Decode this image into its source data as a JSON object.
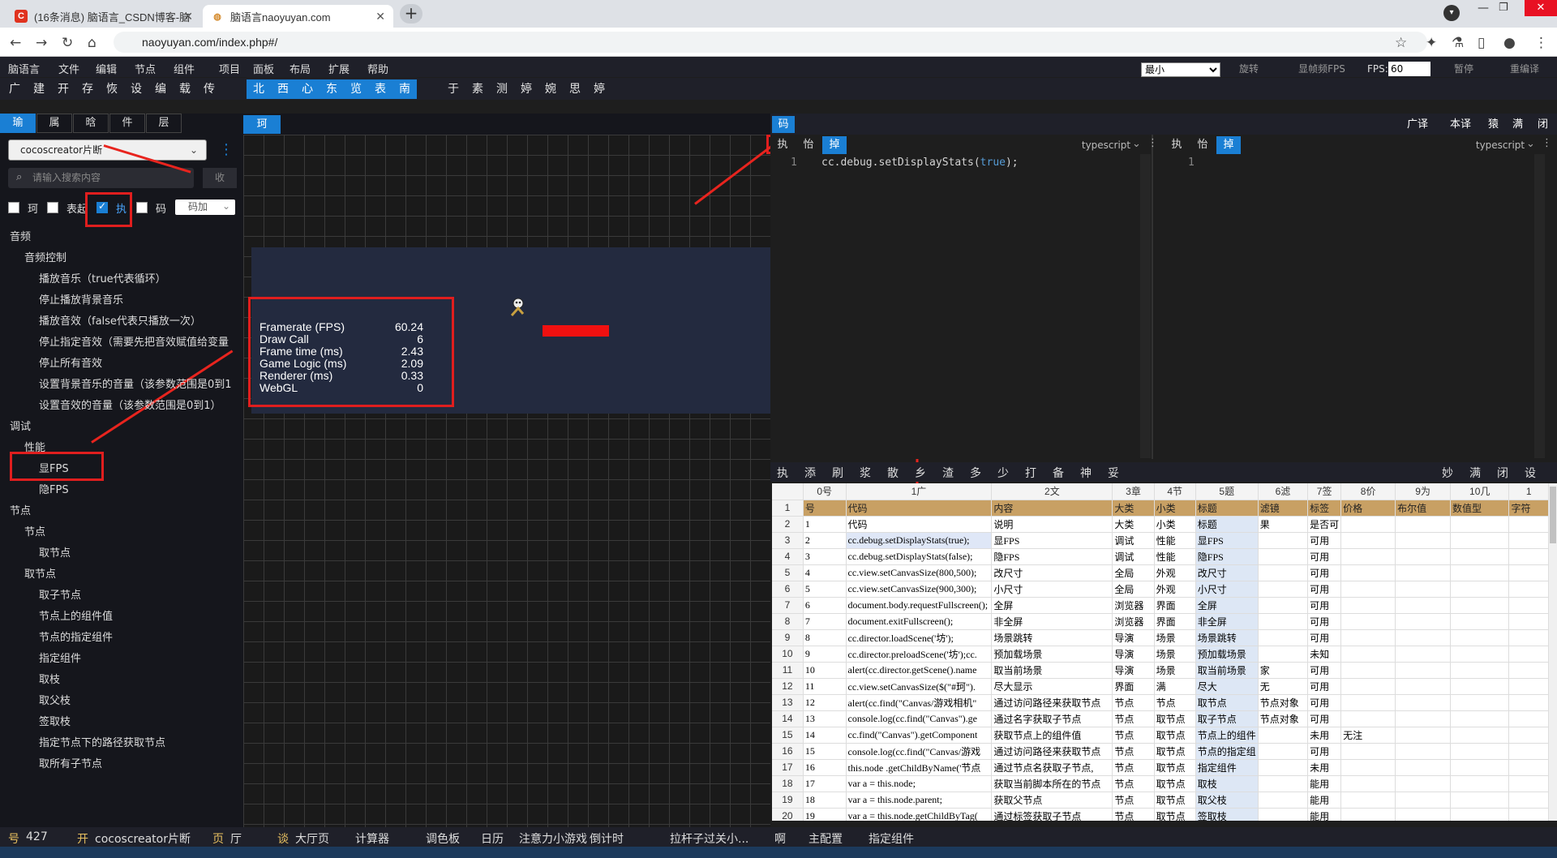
{
  "browser": {
    "tabs": [
      {
        "title": "(16条消息) 脑语言_CSDN博客-脑",
        "fav": "C"
      },
      {
        "title": "脑语言naoyuyan.com",
        "fav": "🧠"
      }
    ],
    "url": "naoyuyan.com/index.php#/"
  },
  "menubar": [
    "脑语言",
    "文件",
    "编辑",
    "节点",
    "组件",
    "项目",
    "面板",
    "布局",
    "扩展",
    "帮助"
  ],
  "toolbar": {
    "plain1": [
      "广",
      "建",
      "开",
      "存",
      "恢",
      "设",
      "编",
      "载",
      "传"
    ],
    "blue": [
      "北",
      "西",
      "心",
      "东",
      "览",
      "表",
      "南"
    ],
    "plain2": [
      "于",
      "素",
      "测",
      "婷",
      "婉",
      "思",
      "婷"
    ]
  },
  "controls": {
    "size_select": "最小",
    "rotate": "旋转",
    "show_fps": "显帧频FPS",
    "fps_label": "FPS:",
    "fps_value": "60",
    "pause": "暂停",
    "reload": "重编译"
  },
  "left": {
    "tabs": [
      "瑜",
      "属",
      "晗",
      "件",
      "层"
    ],
    "dropdown": "cocoscreator片断",
    "search_placeholder": "请输入搜索内容",
    "collapse": "收",
    "checks": [
      "珂",
      "表起",
      "执",
      "码"
    ],
    "code_add": "码加",
    "tree": [
      {
        "t": "音频",
        "l": 0
      },
      {
        "t": "音频控制",
        "l": 1
      },
      {
        "t": "播放音乐（true代表循环）",
        "l": 2
      },
      {
        "t": "停止播放背景音乐",
        "l": 2
      },
      {
        "t": "播放音效（false代表只播放一次）",
        "l": 2
      },
      {
        "t": "停止指定音效（需要先把音效赋值给变量",
        "l": 2
      },
      {
        "t": "停止所有音效",
        "l": 2
      },
      {
        "t": "设置背景音乐的音量（该参数范围是0到1",
        "l": 2
      },
      {
        "t": "设置音效的音量（该参数范围是0到1）",
        "l": 2
      },
      {
        "t": "调试",
        "l": 0
      },
      {
        "t": "性能",
        "l": 1
      },
      {
        "t": "显FPS",
        "l": 2
      },
      {
        "t": "隐FPS",
        "l": 2
      },
      {
        "t": "节点",
        "l": 0
      },
      {
        "t": "节点",
        "l": 1
      },
      {
        "t": "取节点",
        "l": 2
      },
      {
        "t": "取节点",
        "l": 1
      },
      {
        "t": "取子节点",
        "l": 2
      },
      {
        "t": "节点上的组件值",
        "l": 2
      },
      {
        "t": "节点的指定组件",
        "l": 2
      },
      {
        "t": "指定组件",
        "l": 2
      },
      {
        "t": "取枝",
        "l": 2
      },
      {
        "t": "取父枝",
        "l": 2
      },
      {
        "t": "签取枝",
        "l": 2
      },
      {
        "t": "指定节点下的路径获取节点",
        "l": 2
      },
      {
        "t": "取所有子节点",
        "l": 2
      }
    ]
  },
  "scene": {
    "tab": "珂",
    "stats": [
      {
        "k": "Framerate (FPS)",
        "v": "60.24"
      },
      {
        "k": "Draw Call",
        "v": "6"
      },
      {
        "k": "Frame time (ms)",
        "v": "2.43"
      },
      {
        "k": "Game Logic (ms)",
        "v": "2.09"
      },
      {
        "k": "Renderer (ms)",
        "v": "0.33"
      },
      {
        "k": "WebGL",
        "v": "0"
      }
    ]
  },
  "editor": {
    "section": "码",
    "right_tabs": [
      "广译",
      "本译",
      "猿",
      "满",
      "闭"
    ],
    "tabs": [
      "执",
      "怡",
      "掉"
    ],
    "lang": "typescript",
    "line_no": "1",
    "code_pre": "cc.debug.setDisplayStats(",
    "code_kw": "true",
    "code_post": ");"
  },
  "grid": {
    "toolbar_left": [
      "执",
      "添",
      "刷",
      "浆",
      "散",
      "乡",
      "渣",
      "多",
      "少",
      "打",
      "备",
      "神",
      "妥"
    ],
    "toolbar_right": [
      "妙",
      "满",
      "闭",
      "设"
    ],
    "colheads": [
      "",
      "0号",
      "1广",
      "2文",
      "3章",
      "4节",
      "5题",
      "6滤",
      "7签",
      "8价",
      "9为",
      "10几",
      "1"
    ],
    "rows": [
      [
        "1",
        "号",
        "代码",
        "内容",
        "大类",
        "小类",
        "标题",
        "滤镜",
        "标签",
        "价格",
        "布尔值",
        "数值型",
        "字符"
      ],
      [
        "2",
        "1",
        "代码",
        "说明",
        "大类",
        "小类",
        "标题",
        "果",
        "是否可",
        "",
        "",
        "",
        ""
      ],
      [
        "3",
        "2",
        "cc.debug.setDisplayStats(true);",
        "显FPS",
        "调试",
        "性能",
        "显FPS",
        "",
        "可用",
        "",
        "",
        "",
        ""
      ],
      [
        "4",
        "3",
        "cc.debug.setDisplayStats(false);",
        "隐FPS",
        "调试",
        "性能",
        "隐FPS",
        "",
        "可用",
        "",
        "",
        "",
        ""
      ],
      [
        "5",
        "4",
        "cc.view.setCanvasSize(800,500);",
        "改尺寸",
        "全局",
        "外观",
        "改尺寸",
        "",
        "可用",
        "",
        "",
        "",
        ""
      ],
      [
        "6",
        "5",
        "cc.view.setCanvasSize(900,300);",
        "小尺寸",
        "全局",
        "外观",
        "小尺寸",
        "",
        "可用",
        "",
        "",
        "",
        ""
      ],
      [
        "7",
        "6",
        "document.body.requestFullscreen();",
        "全屏",
        "浏览器",
        "界面",
        "全屏",
        "",
        "可用",
        "",
        "",
        "",
        ""
      ],
      [
        "8",
        "7",
        "document.exitFullscreen();",
        "非全屏",
        "浏览器",
        "界面",
        "非全屏",
        "",
        "可用",
        "",
        "",
        "",
        ""
      ],
      [
        "9",
        "8",
        "cc.director.loadScene('坊');",
        "场景跳转",
        "导演",
        "场景",
        "场景跳转",
        "",
        "可用",
        "",
        "",
        "",
        ""
      ],
      [
        "10",
        "9",
        "cc.director.preloadScene('坊');cc.",
        "预加载场景",
        "导演",
        "场景",
        "预加载场景",
        "",
        "未知",
        "",
        "",
        "",
        ""
      ],
      [
        "11",
        "10",
        "alert(cc.director.getScene().name",
        "取当前场景",
        "导演",
        "场景",
        "取当前场景",
        "家",
        "可用",
        "",
        "",
        "",
        ""
      ],
      [
        "12",
        "11",
        "cc.view.setCanvasSize($(\"#珂\").",
        "尽大显示",
        "界面",
        "满",
        "尽大",
        "无",
        "可用",
        "",
        "",
        "",
        ""
      ],
      [
        "13",
        "12",
        "alert(cc.find(\"Canvas/游戏相机\"",
        "通过访问路径来获取节点",
        "节点",
        "节点",
        "取节点",
        "节点对象",
        "可用",
        "",
        "",
        "",
        ""
      ],
      [
        "14",
        "13",
        "console.log(cc.find(\"Canvas\").ge",
        "通过名字获取子节点",
        "节点",
        "取节点",
        "取子节点",
        "节点对象",
        "可用",
        "",
        "",
        "",
        ""
      ],
      [
        "15",
        "14",
        "cc.find(\"Canvas\").getComponent",
        "获取节点上的组件值",
        "节点",
        "取节点",
        "节点上的组件",
        "",
        "未用",
        "无注",
        "",
        "",
        ""
      ],
      [
        "16",
        "15",
        "console.log(cc.find(\"Canvas/游戏",
        "通过访问路径来获取节点",
        "节点",
        "取节点",
        "节点的指定组",
        "",
        "可用",
        "",
        "",
        "",
        ""
      ],
      [
        "17",
        "16",
        "this.node .getChildByName('节点",
        "通过节点名获取子节点,",
        "节点",
        "取节点",
        "指定组件",
        "",
        "未用",
        "",
        "",
        "",
        ""
      ],
      [
        "18",
        "17",
        "var a = this.node;",
        "获取当前脚本所在的节点",
        "节点",
        "取节点",
        "取枝",
        "",
        "能用",
        "",
        "",
        "",
        ""
      ],
      [
        "19",
        "18",
        "var a = this.node.parent;",
        "获取父节点",
        "节点",
        "取节点",
        "取父枝",
        "",
        "能用",
        "",
        "",
        "",
        ""
      ],
      [
        "20",
        "19",
        "var a = this.node.getChildByTag(",
        "通过标签获取子节点",
        "节点",
        "取节点",
        "签取枝",
        "",
        "能用",
        "",
        "",
        "",
        ""
      ]
    ]
  },
  "status": [
    {
      "k": "号",
      "v": "427"
    },
    {
      "k": "开",
      "v": "cocoscreator片断"
    },
    {
      "k": "页",
      "v": "厅"
    },
    {
      "k": "谈",
      "v": "大厅页"
    },
    {
      "k": "",
      "v": "计算器"
    },
    {
      "k": "",
      "v": "调色板"
    },
    {
      "k": "",
      "v": "日历"
    },
    {
      "k": "",
      "v": "注意力小游戏"
    },
    {
      "k": "",
      "v": "倒计时"
    },
    {
      "k": "",
      "v": "拉杆子过关小..."
    },
    {
      "k": "",
      "v": "啊"
    },
    {
      "k": "",
      "v": "主配置"
    },
    {
      "k": "",
      "v": "指定组件"
    }
  ],
  "colors": {
    "accent": "#1a7fd4",
    "annotation": "#e8241e",
    "grid_header": "#c8a064"
  }
}
